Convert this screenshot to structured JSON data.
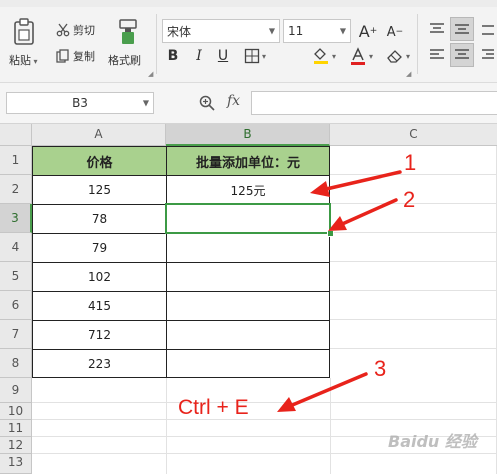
{
  "ribbon": {
    "paste_label": "粘贴",
    "cut_label": "剪切",
    "copy_label": "复制",
    "format_painter_label": "格式刷",
    "font_name": "宋体",
    "font_size": "11",
    "grow_font": "A",
    "shrink_font": "A",
    "bold": "B",
    "italic": "I",
    "underline": "U"
  },
  "formula_bar": {
    "name_box": "B3",
    "fx_label": "fx",
    "formula_value": ""
  },
  "sheet": {
    "columns": [
      "A",
      "B",
      "C"
    ],
    "rows": [
      "1",
      "2",
      "3",
      "4",
      "5",
      "6",
      "7",
      "8",
      "9",
      "10",
      "11",
      "12",
      "13"
    ],
    "header_a": "价格",
    "header_b": "批量添加单位：元",
    "prices": [
      "125",
      "78",
      "79",
      "102",
      "415",
      "712",
      "223"
    ],
    "b2": "125元",
    "active_cell": "B3"
  },
  "annotations": {
    "n1": "1",
    "n2": "2",
    "n3": "3",
    "shortcut": "Ctrl + E",
    "color": "#e8231b"
  },
  "watermark": "Baidu 经验"
}
